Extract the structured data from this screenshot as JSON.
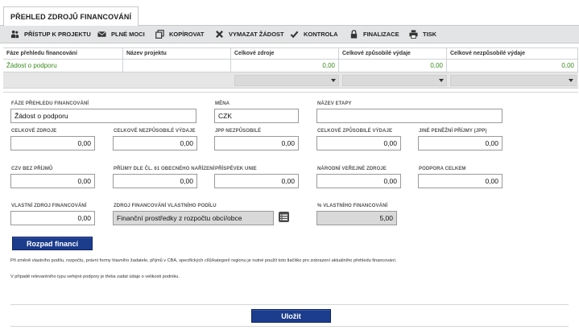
{
  "tabs": [
    {
      "label": "PŘEHLED ZDROJŮ FINANCOVÁNÍ",
      "active": true
    }
  ],
  "toolbar": {
    "buttons": [
      {
        "label": "PŘÍSTUP K PROJEKTU",
        "icon": "people-icon"
      },
      {
        "label": "PLNÉ MOCI",
        "icon": "envelope-icon"
      },
      {
        "label": "KOPÍROVAT",
        "icon": "copy-icon"
      },
      {
        "label": "VYMAZAT ŽÁDOST",
        "icon": "cross-icon"
      },
      {
        "label": "KONTROLA",
        "icon": "check-icon"
      },
      {
        "label": "FINALIZACE",
        "icon": "lock-icon"
      },
      {
        "label": "TISK",
        "icon": "printer-icon"
      }
    ]
  },
  "grid": {
    "headers": [
      "Fáze přehledu financování",
      "Název projektu",
      "Celkové zdroje",
      "Celkové způsobilé výdaje",
      "Celkové nezpůsobilé výdaje"
    ],
    "rows": [
      [
        "Žádost o podporu",
        "",
        "0,00",
        "0,00",
        "0,00"
      ]
    ]
  },
  "form": {
    "faze": {
      "label": "FÁZE PŘEHLEDU FINANCOVÁNÍ",
      "value": "Žádost o podporu"
    },
    "mena": {
      "label": "MĚNA",
      "value": "CZK"
    },
    "nazev_etapy": {
      "label": "NÁZEV ETAPY",
      "value": ""
    },
    "celkove_zdroje": {
      "label": "CELKOVÉ ZDROJE",
      "value": "0,00"
    },
    "celkove_nezpusobile": {
      "label": "CELKOVÉ NEZPŮSOBILÉ VÝDAJE",
      "value": "0,00"
    },
    "jpp_nezpusobile": {
      "label": "JPP NEZPŮSOBILÉ",
      "value": "0,00"
    },
    "celkove_zpusobile": {
      "label": "CELKOVÉ ZPŮSOBILÉ VÝDAJE",
      "value": "0,00"
    },
    "jine_penezni": {
      "label": "JINÉ PENĚŽNÍ PŘÍJMY (JPP)",
      "value": "0,00"
    },
    "czv_bez_prijmu": {
      "label": "CZV BEZ PŘÍJMŮ",
      "value": "0,00"
    },
    "prijmy_61": {
      "label": "PŘÍJMY DLE ČL. 61 OBECNÉHO NAŘÍZENÍ",
      "value": "0,00"
    },
    "prispevek_unie": {
      "label": "PŘÍSPĚVEK UNIE",
      "value": "0,00"
    },
    "narodni_zdroje": {
      "label": "NÁRODNÍ VEŘEJNÉ ZDROJE",
      "value": "0,00"
    },
    "podpora_celkem": {
      "label": "PODPORA CELKEM",
      "value": "0,00"
    },
    "vlastni_zdroj": {
      "label": "VLASTNÍ ZDROJ FINANCOVÁNÍ",
      "value": "0,00"
    },
    "zdroj_vlastniho": {
      "label": "ZDROJ FINANCOVÁNÍ VLASTNÍHO PODÍLU",
      "value": "Finanční prostředky z rozpočtu obcí/obce"
    },
    "procento_vlastniho": {
      "label": "% VLASTNÍHO FINANCOVÁNÍ",
      "value": "5,00"
    }
  },
  "buttons": {
    "rozpad": "Rozpad financí",
    "ulozit": "Uložit"
  },
  "notes": [
    "Při změně vlastního podílu, rozpočtu, právní formy hlavního žadatele, příjmů v CBA, specifických cílů/kategorií regionu je nutné použít toto tlačítko pro zobrazení aktuálního přehledu financování.",
    "V případě relevantního typu veřejné podpory je třeba zadat údaje o velikosti podniku."
  ],
  "colors": {
    "accent": "#1c3c8c",
    "green_text": "#3a8a1e",
    "toolbar_bg": "#e3e4e6"
  }
}
